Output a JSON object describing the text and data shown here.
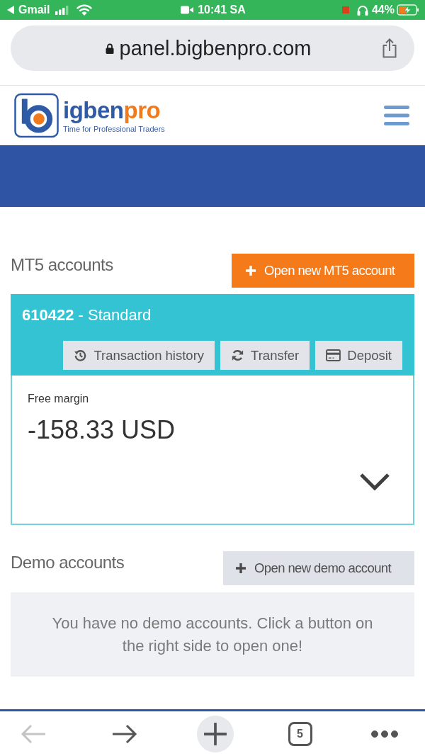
{
  "status_bar": {
    "back_label": "Gmail",
    "time": "10:41 SA",
    "battery_text": "44%"
  },
  "address_bar": {
    "url": "panel.bigbenpro.com"
  },
  "header": {
    "logo": {
      "name_start": "igben",
      "name_end": "pro",
      "tagline": "Time for Professional Traders"
    }
  },
  "mt5_section": {
    "title": "MT5 accounts",
    "open_button": "Open new MT5 account",
    "accounts": [
      {
        "title": "**610422** - Standard",
        "actions": [
          {
            "kind": "history",
            "label": "Transaction history"
          },
          {
            "kind": "transfer",
            "label": "Transfer"
          },
          {
            "kind": "deposit",
            "label": "Deposit"
          }
        ],
        "free_margin_label": "Free margin",
        "free_margin": "-158.33 USD",
        "expanded": false
      }
    ]
  },
  "demo_section": {
    "title": "Demo accounts",
    "open_button": "Open new demo account",
    "empty_message": "You have no demo accounts. Click a button on the right side to open one!"
  },
  "browser_toolbar": {
    "buttons": [
      {
        "kind": "back",
        "disabled": true
      },
      {
        "kind": "forward",
        "disabled": false
      },
      {
        "kind": "new_tab",
        "disabled": false
      },
      {
        "kind": "tabs",
        "count": "5",
        "disabled": false
      },
      {
        "kind": "more",
        "disabled": false
      }
    ]
  }
}
